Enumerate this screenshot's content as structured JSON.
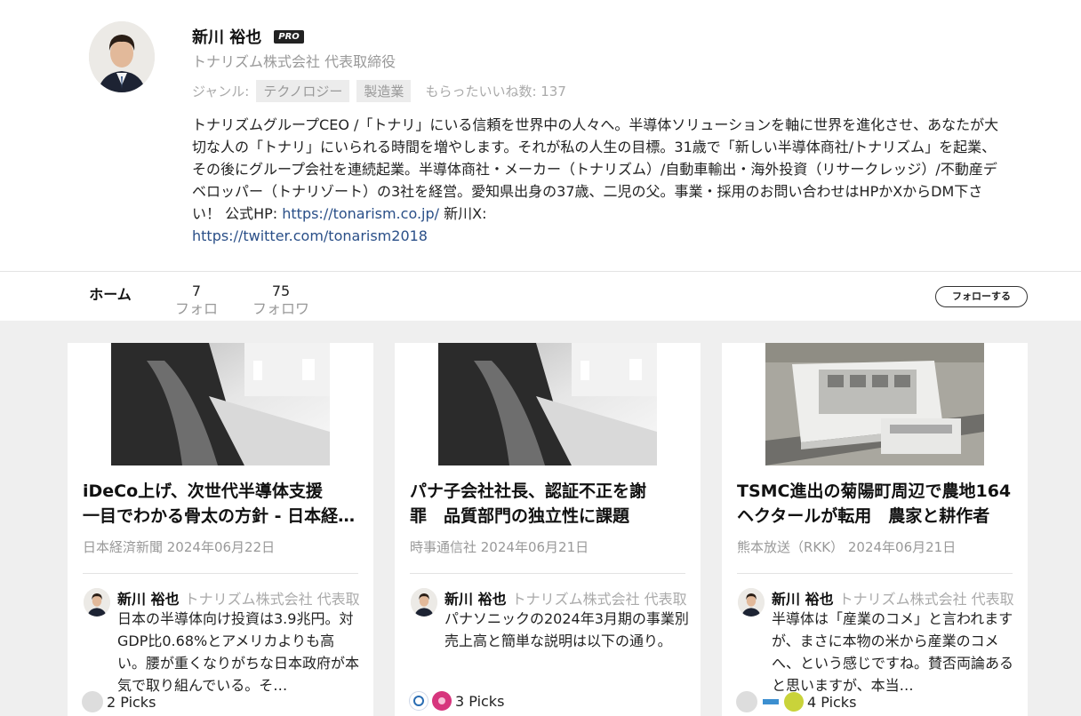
{
  "profile": {
    "name": "新川 裕也",
    "badge": "PRO",
    "company": "トナリズム株式会社 代表取締役",
    "genre_label": "ジャンル:",
    "genres": [
      "テクノロジー",
      "製造業"
    ],
    "likes": "もらったいいね数: 137",
    "bio_text": "トナリズムグループCEO /「トナリ」にいる信頼を世界中の人々へ。半導体ソリューションを軸に世界を進化させ、あなたが大切な人の「トナリ」にいられる時間を増やします。それが私の人生の目標。31歳で「新しい半導体商社/トナリズム」を起業、その後にグループ会社を連続起業。半導体商社・メーカー（トナリズム）/自動車輸出・海外投資（リサークレッジ）/不動産デベロッパー（トナリゾート）の3社を経営。愛知県出身の37歳、二児の父。事業・採用のお問い合わせはHPかXからDM下さい！ 公式HP: ",
    "bio_link1": "https://tonarism.co.jp/",
    "bio_mid": " 新川X: ",
    "bio_link2": "https://twitter.com/tonarism2018"
  },
  "tabs": {
    "home": "ホーム",
    "follow_count": "7",
    "follow_label": "フォロー",
    "follower_count": "75",
    "follower_label": "フォロワー"
  },
  "follow_button": "フォローする",
  "cards": [
    {
      "title_line1": "iDeCo上げ、次世代半導体支援",
      "title_line2": "一目でわかる骨太の方針 - 日本経済新聞",
      "source": "日本経済新聞  2024年06月22日",
      "commenter": "新川 裕也",
      "commenter_company": "トナリズム株式会社 代表取締役",
      "comment": "日本の半導体向け投資は3.9兆円。対GDP比0.68%とアメリカよりも高い。腰が重くなりがちな日本政府が本気で取り組んでいる。そ…",
      "picks": "2 Picks"
    },
    {
      "title_line1": "パナ子会社社長、認証不正を謝",
      "title_line2": "罪　品質部門の独立性に課題",
      "source": "時事通信社  2024年06月21日",
      "commenter": "新川 裕也",
      "commenter_company": "トナリズム株式会社 代表取締役",
      "comment": "パナソニックの2024年3月期の事業別売上高と簡単な説明は以下の通り。",
      "picks": "3 Picks"
    },
    {
      "title_line1": "TSMC進出の菊陽町周辺で農地164",
      "title_line2": "ヘクタールが転用　農家と耕作者",
      "source": "熊本放送（RKK）  2024年06月21日",
      "commenter": "新川 裕也",
      "commenter_company": "トナリズム株式会社 代表取締役",
      "comment": "半導体は「産業のコメ」と言われますが、まさに本物の米から産業のコメへ、という感じですね。賛否両論あると思いますが、本当…",
      "picks": "4 Picks"
    }
  ]
}
